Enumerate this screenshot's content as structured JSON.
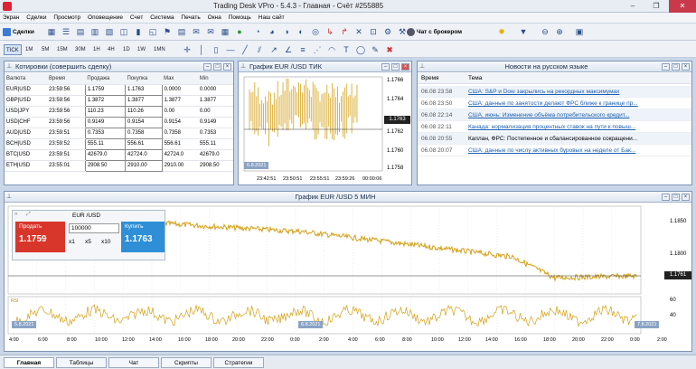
{
  "app": {
    "title": "Trading Desk VPro - 5.4.3 - Главная - Счёт #255885"
  },
  "window_controls": {
    "minimize": "–",
    "maximize": "❐",
    "close": "✕"
  },
  "menu": [
    "Экран",
    "Сделки",
    "Просмотр",
    "Оповещение",
    "Счет",
    "Система",
    "Печать",
    "Окна",
    "Помощь",
    "Наш сайт"
  ],
  "toolbar": {
    "deals_label": "Сделки",
    "broker_chat_label": "Чат с брокером"
  },
  "timeframes": [
    "TICK",
    "1M",
    "5M",
    "15M",
    "30M",
    "1H",
    "4H",
    "1D",
    "1W",
    "1MN"
  ],
  "quotes": {
    "title": "Котировки (совершить сделку)",
    "columns": [
      "Валюта",
      "Время",
      "Продажа",
      "Покупка",
      "Max",
      "Min"
    ],
    "rows": [
      [
        "EUR|USD",
        "23:59:56",
        "1.1759",
        "1.1763",
        "0.0000",
        "0.0000"
      ],
      [
        "GBP|USD",
        "23:59:56",
        "1.3872",
        "1.3877",
        "1.3877",
        "1.3877"
      ],
      [
        "USD|JPY",
        "23:59:56",
        "110.23",
        "110.26",
        "0.00",
        "0.00"
      ],
      [
        "USD|CHF",
        "23:59:56",
        "0.9149",
        "0.9154",
        "0.9154",
        "0.9149"
      ],
      [
        "AUD|USD",
        "23:59:51",
        "0.7353",
        "0.7358",
        "0.7358",
        "0.7353"
      ],
      [
        "BCH|USD",
        "23:59:52",
        "555.11",
        "556.61",
        "556.61",
        "555.11"
      ],
      [
        "BTC|USD",
        "23:59:51",
        "42679.0",
        "42724.0",
        "42724.0",
        "42679.0"
      ],
      [
        "ETH|USD",
        "23:55:01",
        "2908.50",
        "2910.00",
        "2910.00",
        "2908.50"
      ]
    ]
  },
  "tick_chart": {
    "title": "График EUR /USD  ТИК",
    "price_labels": [
      "1.1766",
      "1.1764",
      "1.1762",
      "1.1760",
      "1.1758"
    ],
    "current_price": "1.1763",
    "date_label": "6.8.2021",
    "time_labels": [
      "23:42:51",
      "23:50:51",
      "23:55:51",
      "23:59:26",
      "00:00:06"
    ]
  },
  "news": {
    "title": "Новости на русском языке",
    "columns": [
      "Время",
      "Тема"
    ],
    "rows": [
      {
        "time": "06.08 23:58",
        "text": "США: S&P и Dow закрылись на рекордных максимумах",
        "link": true
      },
      {
        "time": "06.08 23:50",
        "text": "США: данные по занятости делают ФРС ближе к границе пр...",
        "link": true
      },
      {
        "time": "06.08 22:14",
        "text": "США, июнь: Изменение объёма потребительского кредит...",
        "link": true
      },
      {
        "time": "06.08 22:11",
        "text": "Канада: нормализация процентных ставок на пути к повыш...",
        "link": true
      },
      {
        "time": "06.08 20:55",
        "text": "Каплан, ФРС: Постепенное и сбалансированное сокращени...",
        "link": false
      },
      {
        "time": "06.08 20:07",
        "text": "США: данные по числу активных буровых на неделе от Бак...",
        "link": true
      }
    ]
  },
  "main_chart": {
    "title": "График EUR /USD  5 МИН",
    "price_labels": [
      "1.1850",
      "1.1800"
    ],
    "current_price": "1.1761",
    "osc_labels": [
      "60",
      "40"
    ],
    "osc_tag": "RSI",
    "date_tags": [
      "5.8.2021",
      "6.8.2021",
      "7.8.2021"
    ],
    "time_labels": [
      "4:00",
      "6:00",
      "8:00",
      "10:00",
      "12:00",
      "14:00",
      "16:00",
      "18:00",
      "20:00",
      "22:00",
      "0:00",
      "2:00",
      "4:00",
      "6:00",
      "8:00",
      "10:00",
      "12:00",
      "14:00",
      "16:00",
      "18:00",
      "20:00",
      "22:00",
      "0:00",
      "2:00"
    ]
  },
  "trade_widget": {
    "symbol": "EUR /USD",
    "amount": "100000",
    "multipliers": [
      "x1",
      "x5",
      "x10"
    ],
    "sell_label": "Продать",
    "sell_price": "1.1759",
    "buy_label": "Купить",
    "buy_price": "1.1763"
  },
  "bottom_tabs": [
    "Главная",
    "Таблицы",
    "Чат",
    "Скрипты",
    "Стратегии"
  ],
  "colors": {
    "sell": "#d9362b",
    "buy": "#2f8fd6",
    "price_line": "#d4a017",
    "panel_border": "#7f95b5",
    "link": "#1b5fb0"
  }
}
